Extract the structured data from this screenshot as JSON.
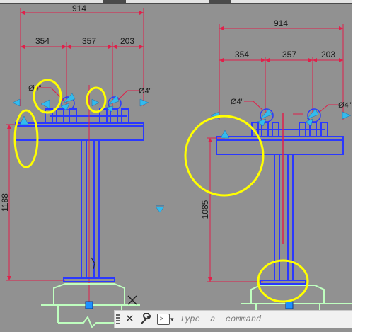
{
  "colors": {
    "background": "#919191",
    "structure": "#2a38ff",
    "dimension": "#e0204a",
    "grip": "#33bbee",
    "highlight": "#ffff00",
    "ucs": "#bfffbf"
  },
  "left_view": {
    "overall": "914",
    "seg1": "354",
    "seg2": "357",
    "seg3": "203",
    "height": "1188",
    "label_left": "Ø4\"",
    "label_right": "Ø4\""
  },
  "right_view": {
    "overall": "914",
    "seg1": "354",
    "seg2": "357",
    "seg3": "203",
    "height": "1085",
    "label_left": "Ø4\"",
    "label_right": "Ø4\""
  },
  "command_line": {
    "placeholder": "Type  a  command",
    "close_icon": "close-icon",
    "settings_icon": "wrench-icon",
    "prompt_icon": "command-prompt-icon",
    "prompt_symbol": ">_",
    "caret": "▾"
  }
}
